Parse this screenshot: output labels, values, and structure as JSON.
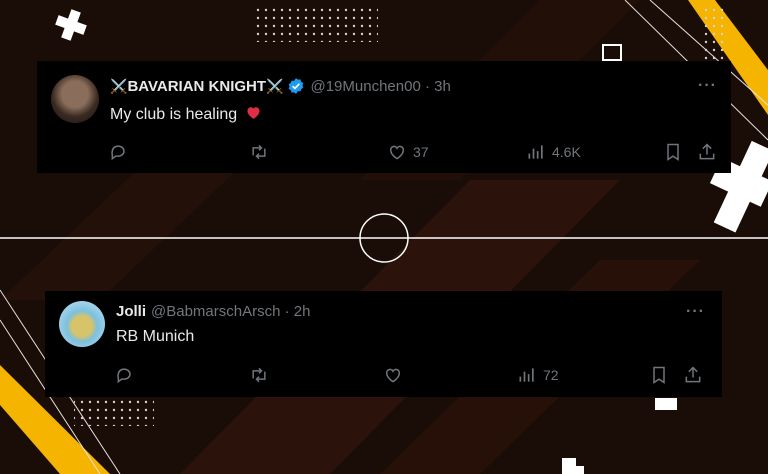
{
  "colors": {
    "background": "#1a0c07",
    "card": "#000000",
    "accent_yellow": "#f5b400",
    "muted": "#71767b",
    "verified_blue": "#1d9bf0",
    "heart": "#f91880"
  },
  "tweets": [
    {
      "swords": "⚔️",
      "name": "BAVARIAN KNIGHT",
      "verified": true,
      "handle": "@19Munchen00 · 3h",
      "text": "My club is healing",
      "emoji_icon": "red-heart-icon",
      "actions": {
        "reply": "",
        "retweet": "",
        "likes": "37",
        "views": "4.6K"
      }
    },
    {
      "name": "Jolli",
      "handle": "@BabmarschArsch · 2h",
      "text": "RB Munich",
      "actions": {
        "reply": "",
        "retweet": "",
        "likes": "",
        "views": "72"
      }
    }
  ],
  "more_label": "···"
}
